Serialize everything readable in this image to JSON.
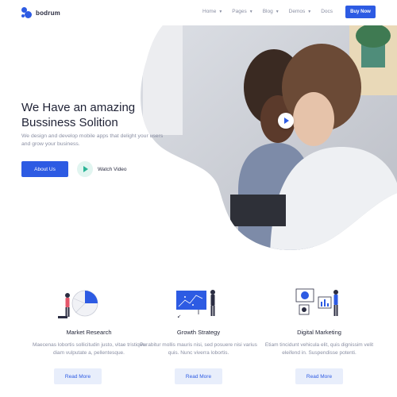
{
  "header": {
    "logo_text": "bodrum",
    "nav": [
      {
        "label": "Home",
        "has_dropdown": true
      },
      {
        "label": "Pages",
        "has_dropdown": true
      },
      {
        "label": "Blog",
        "has_dropdown": true
      },
      {
        "label": "Demos",
        "has_dropdown": true
      },
      {
        "label": "Docs",
        "has_dropdown": false
      }
    ],
    "cta_label": "Buy Now"
  },
  "hero": {
    "title_line1": "We Have an amazing",
    "title_line2": "Bussiness Solition",
    "description": "We design and develop mobile apps that delight your users and grow your business.",
    "primary_button": "About Us",
    "video_label": "Watch Video"
  },
  "features": [
    {
      "title": "Market Research",
      "description": "Maecenas lobortis sollicitudin justo, vitae tristique diam vulputate a, pellentesque.",
      "button": "Read More",
      "icon": "pie-chart-person-illustration"
    },
    {
      "title": "Growth Strategy",
      "description": "Purabitur mollis mauris nisi, sed posuere nisi varius quis. Nunc viverra lobortis.",
      "button": "Read More",
      "icon": "board-person-illustration"
    },
    {
      "title": "Digital Marketing",
      "description": "Etiam tincidunt vehicula elit, quis dignissim velit eleifend in. Suspendisse potenti.",
      "button": "Read More",
      "icon": "dashboard-person-illustration"
    }
  ],
  "colors": {
    "brand": "#2d5be3",
    "video_accent": "#2bb496",
    "heading": "#1f2235",
    "muted": "#8a8fa3"
  }
}
